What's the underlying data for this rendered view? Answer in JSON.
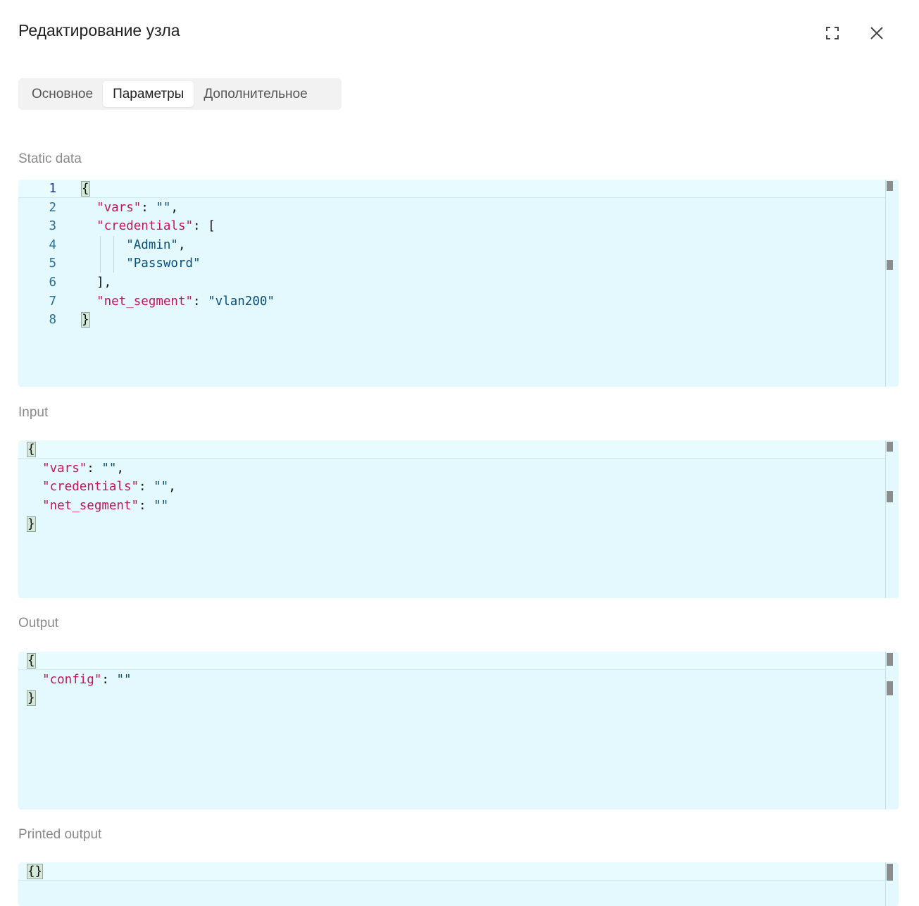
{
  "dialog": {
    "title": "Редактирование узла",
    "expand_icon": "expand-icon",
    "close_icon": "close-icon"
  },
  "tabs": [
    {
      "label": "Основное",
      "active": false
    },
    {
      "label": "Параметры",
      "active": true
    },
    {
      "label": "Дополнительное",
      "active": false
    }
  ],
  "sections": {
    "static_data": {
      "label": "Static data",
      "line_numbers": [
        "1",
        "2",
        "3",
        "4",
        "5",
        "6",
        "7",
        "8"
      ],
      "lines": [
        [
          {
            "t": "{",
            "c": "brace"
          }
        ],
        [
          {
            "t": "  ",
            "c": "p"
          },
          {
            "t": "\"vars\"",
            "c": "k"
          },
          {
            "t": ": ",
            "c": "p"
          },
          {
            "t": "\"\"",
            "c": "s"
          },
          {
            "t": ",",
            "c": "p"
          }
        ],
        [
          {
            "t": "  ",
            "c": "p"
          },
          {
            "t": "\"credentials\"",
            "c": "k"
          },
          {
            "t": ": [",
            "c": "p"
          }
        ],
        [
          {
            "t": "      ",
            "c": "p"
          },
          {
            "t": "\"Admin\"",
            "c": "s"
          },
          {
            "t": ",",
            "c": "p"
          }
        ],
        [
          {
            "t": "      ",
            "c": "p"
          },
          {
            "t": "\"Password\"",
            "c": "s"
          }
        ],
        [
          {
            "t": "  ],",
            "c": "p"
          }
        ],
        [
          {
            "t": "  ",
            "c": "p"
          },
          {
            "t": "\"net_segment\"",
            "c": "k"
          },
          {
            "t": ": ",
            "c": "p"
          },
          {
            "t": "\"vlan200\"",
            "c": "s"
          }
        ],
        [
          {
            "t": "}",
            "c": "brace"
          }
        ]
      ]
    },
    "input": {
      "label": "Input",
      "lines": [
        [
          {
            "t": "{",
            "c": "brace"
          }
        ],
        [
          {
            "t": "  ",
            "c": "p"
          },
          {
            "t": "\"vars\"",
            "c": "k"
          },
          {
            "t": ": ",
            "c": "p"
          },
          {
            "t": "\"\"",
            "c": "s"
          },
          {
            "t": ",",
            "c": "p"
          }
        ],
        [
          {
            "t": "  ",
            "c": "p"
          },
          {
            "t": "\"credentials\"",
            "c": "k"
          },
          {
            "t": ": ",
            "c": "p"
          },
          {
            "t": "\"\"",
            "c": "s"
          },
          {
            "t": ",",
            "c": "p"
          }
        ],
        [
          {
            "t": "  ",
            "c": "p"
          },
          {
            "t": "\"net_segment\"",
            "c": "k"
          },
          {
            "t": ": ",
            "c": "p"
          },
          {
            "t": "\"\"",
            "c": "s"
          }
        ],
        [
          {
            "t": "}",
            "c": "brace"
          }
        ]
      ]
    },
    "output": {
      "label": "Output",
      "lines": [
        [
          {
            "t": "{",
            "c": "brace"
          }
        ],
        [
          {
            "t": "  ",
            "c": "p"
          },
          {
            "t": "\"config\"",
            "c": "k"
          },
          {
            "t": ": ",
            "c": "p"
          },
          {
            "t": "\"\"",
            "c": "s"
          }
        ],
        [
          {
            "t": "}",
            "c": "brace"
          }
        ]
      ]
    },
    "printed_output": {
      "label": "Printed output",
      "lines": [
        [
          {
            "t": "{}",
            "c": "brace"
          }
        ]
      ]
    }
  },
  "colors": {
    "editor_bg": "#e4f9fe",
    "key": "#c5145a",
    "string": "#0b4f7a",
    "label": "#8a8a8a"
  }
}
